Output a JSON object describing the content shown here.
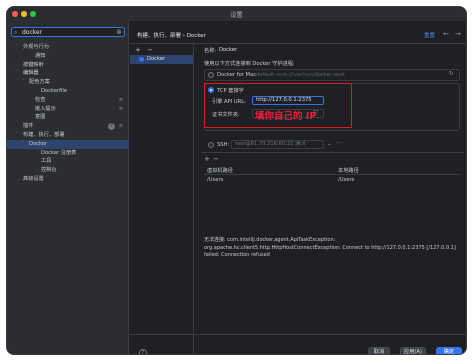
{
  "window": {
    "title": "设置"
  },
  "search": {
    "value": "docker"
  },
  "tree": [
    {
      "label": "外观与行为",
      "arrow": "˅",
      "level": 0
    },
    {
      "label": "通知",
      "arrow": "",
      "level": 2
    },
    {
      "label": "按键映射",
      "arrow": "",
      "level": 0
    },
    {
      "label": "编辑器",
      "arrow": "˅",
      "level": 0
    },
    {
      "label": "配色方案",
      "arrow": "˅",
      "level": 1
    },
    {
      "label": "Dockerfile",
      "arrow": "",
      "level": 3
    },
    {
      "label": "检查",
      "arrow": "",
      "level": 2,
      "badge": "≡"
    },
    {
      "label": "嵌入提示",
      "arrow": "",
      "level": 2,
      "badge": "≡"
    },
    {
      "label": "意图",
      "arrow": "",
      "level": 2
    },
    {
      "label": "插件",
      "arrow": "",
      "level": 0,
      "help": "?",
      "badge": "≡"
    },
    {
      "label": "构建、执行、部署",
      "arrow": "˅",
      "level": 0
    },
    {
      "label": "Docker",
      "arrow": "˅",
      "level": 1,
      "selected": true
    },
    {
      "label": "Docker 注册表",
      "arrow": "",
      "level": 3
    },
    {
      "label": "工具",
      "arrow": "",
      "level": 3
    },
    {
      "label": "控制台",
      "arrow": "",
      "level": 3
    },
    {
      "label": "高级设置",
      "arrow": "",
      "level": 0
    }
  ],
  "header": {
    "breadcrumb": "构建、执行、部署  ›  Docker",
    "reset": "重置",
    "back": "←",
    "forward": "→"
  },
  "list": {
    "add": "+",
    "remove": "−",
    "items": [
      "Docker"
    ]
  },
  "detail": {
    "name_label": "名称:",
    "name_value": "Docker",
    "connect_label": "使用以下方式连接到 Docker 守护进程:",
    "docker_for_mac": "Docker for Mac",
    "docker_for_mac_path": "default unix:///var/run/docker.sock",
    "tcp_label": "TCP 套接字",
    "engine_api_label": "引擎 API URL:",
    "engine_api_value": "http://127.0.0.1:2375",
    "cert_label": "证书文件夹:",
    "annotation": "填你自己的 IP",
    "ssh_label": "SSH:",
    "ssh_value": "root@61.70.216.60:22 通讯",
    "add": "+",
    "remove": "−",
    "table_headers": [
      "虚拟机路径",
      "本地路径"
    ],
    "table_rows": [
      [
        "/Users",
        "/Users"
      ]
    ],
    "error_text": "无法连接: com.intellij.docker.agent.ApiTaskException: org.apache.hc.client5.http.HttpHostConnectException: Connect to http://127.0.0.1:2375 [/127.0.0.1] failed: Connection refused"
  },
  "buttons": {
    "help": "?",
    "cancel": "取消",
    "apply": "应用(A)",
    "ok": "确定"
  },
  "colors": {
    "accent": "#3574f0",
    "annotation": "#e0191c"
  }
}
